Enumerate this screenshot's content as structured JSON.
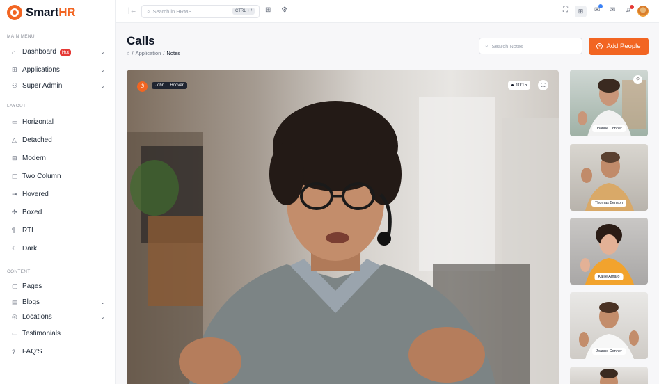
{
  "app": {
    "logo_main": "Smart",
    "logo_accent": "HR"
  },
  "sidebar": {
    "main_menu_title": "MAIN MENU",
    "main_menu": [
      {
        "label": "Dashboard",
        "icon": "home-icon",
        "badge": "Hot",
        "chevron": "⌄"
      },
      {
        "label": "Applications",
        "icon": "apps-icon",
        "chevron": "⌄"
      },
      {
        "label": "Super Admin",
        "icon": "users-icon",
        "chevron": "⌄"
      }
    ],
    "layout_title": "LAYOUT",
    "layout": [
      {
        "label": "Horizontal",
        "icon": "horizontal-icon"
      },
      {
        "label": "Detached",
        "icon": "detached-icon"
      },
      {
        "label": "Modern",
        "icon": "modern-icon"
      },
      {
        "label": "Two Column",
        "icon": "two-column-icon"
      },
      {
        "label": "Hovered",
        "icon": "hovered-icon"
      },
      {
        "label": "Boxed",
        "icon": "boxed-icon"
      },
      {
        "label": "RTL",
        "icon": "rtl-icon"
      },
      {
        "label": "Dark",
        "icon": "moon-icon"
      }
    ],
    "content_title": "CONTENT",
    "content": [
      {
        "label": "Pages",
        "icon": "pages-icon"
      },
      {
        "label": "Blogs",
        "icon": "blogs-icon",
        "chevron": "⌄"
      },
      {
        "label": "Locations",
        "icon": "location-icon",
        "chevron": "⌄"
      },
      {
        "label": "Testimonials",
        "icon": "testimonials-icon"
      },
      {
        "label": "FAQ'S",
        "icon": "faq-icon"
      }
    ]
  },
  "topbar": {
    "search_placeholder": "Search in HRMS",
    "shortcut": "CTRL + /"
  },
  "header": {
    "title": "Calls",
    "breadcrumb_parent": "Application",
    "breadcrumb_current": "Notes",
    "notes_search_placeholder": "Search Notes",
    "add_button": "Add People"
  },
  "main_video": {
    "participant": "John L. Hoover",
    "timer": "10:15"
  },
  "participants": [
    {
      "name": "Joanne Conner"
    },
    {
      "name": "Thomas Benson"
    },
    {
      "name": "Kallie Amaro"
    },
    {
      "name": "Joanne Conner"
    }
  ],
  "colors": {
    "accent": "#f26522",
    "badge": "#e53935"
  }
}
